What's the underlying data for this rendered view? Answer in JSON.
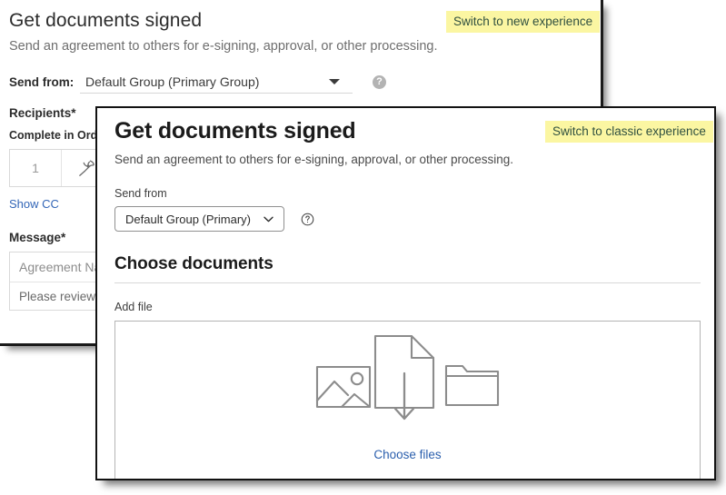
{
  "classic": {
    "title": "Get documents signed",
    "subtitle": "Send an agreement to others for e-signing, approval, or other processing.",
    "send_from_label": "Send from:",
    "send_from_value": "Default Group (Primary Group)",
    "help_glyph": "?",
    "recipients_label": "Recipients",
    "recipients_required": "*",
    "complete_in_order_label": "Complete in Order",
    "recipient_number": "1",
    "show_cc_label": "Show CC",
    "message_label": "Message",
    "message_required": "*",
    "agreement_name_value": "Agreement Name",
    "message_body_value": "Please review and sign this document.",
    "switch_button_label": "Switch to new experience"
  },
  "new": {
    "title": "Get documents signed",
    "subtitle": "Send an agreement to others for e-signing, approval, or other processing.",
    "send_from_label": "Send from",
    "send_from_value": "Default Group (Primary)",
    "choose_documents_heading": "Choose documents",
    "add_file_label": "Add file",
    "choose_files_link": "Choose files",
    "switch_button_label": "Switch to classic experience"
  },
  "colors": {
    "highlight": "#fbf6a2",
    "link": "#2b5fad",
    "classic_link": "#3366b7",
    "text": "#1b1b1b",
    "muted": "#6e6e6e",
    "border": "#b4b4b4"
  }
}
